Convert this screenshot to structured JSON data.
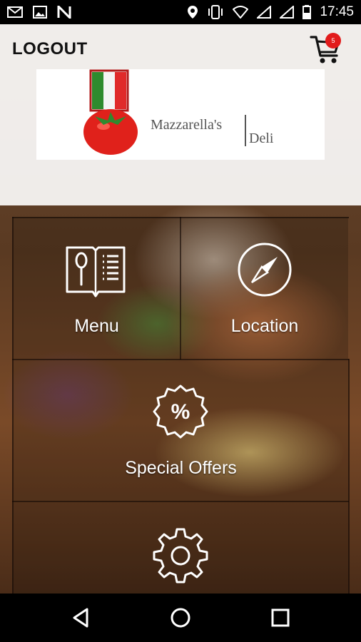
{
  "status_bar": {
    "time": "17:45",
    "left_icons": [
      "gmail-icon",
      "image-icon",
      "n-notification-icon"
    ],
    "right_icons": [
      "location-icon",
      "vibrate-icon",
      "wifi-icon",
      "signal-icon",
      "signal-icon",
      "battery-icon"
    ]
  },
  "header": {
    "logout_label": "LOGOUT",
    "cart_count": "5"
  },
  "logo": {
    "name_part1": "Mazzarella's",
    "name_part2": "Deli"
  },
  "tiles": [
    {
      "label": "Menu",
      "icon": "menu-book-icon"
    },
    {
      "label": "Location",
      "icon": "compass-icon"
    },
    {
      "label": "Special Offers",
      "icon": "percent-badge-icon"
    },
    {
      "label": "",
      "icon": "settings-gear-icon"
    }
  ],
  "nav_bar": {
    "buttons": [
      "back-icon",
      "home-icon",
      "recents-icon"
    ]
  },
  "colors": {
    "cart_badge": "#e21b1b",
    "status_bar_bg": "#000000",
    "tile_text": "#ffffff"
  }
}
